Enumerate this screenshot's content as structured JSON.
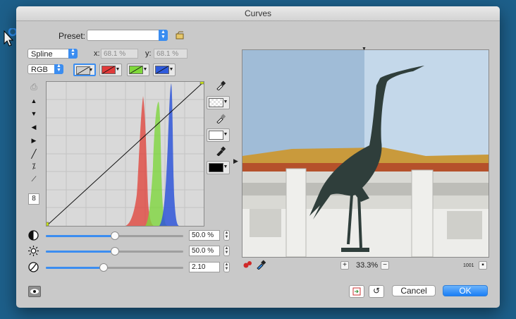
{
  "window": {
    "title": "Curves"
  },
  "preset": {
    "label": "Preset:",
    "value": ""
  },
  "mode": {
    "value": "Spline"
  },
  "channel": {
    "value": "RGB"
  },
  "coords": {
    "x_label": "x:",
    "x_value": "68.1 %",
    "y_label": "y:",
    "y_value": "68.1 %"
  },
  "curve_buttons": [
    {
      "name": "rgb",
      "color": "#cfcfcf"
    },
    {
      "name": "red",
      "color": "#e03a3a"
    },
    {
      "name": "green",
      "color": "#7fd83a"
    },
    {
      "name": "blue",
      "color": "#2f5bdc"
    }
  ],
  "tools": {
    "step_value": "8"
  },
  "sliders": [
    {
      "name": "contrast",
      "value": "50.0 %",
      "fraction": 0.5
    },
    {
      "name": "brightness",
      "value": "50.0 %",
      "fraction": 0.5
    },
    {
      "name": "gamma",
      "value": "2.10",
      "fraction": 0.42
    }
  ],
  "zoom": {
    "value": "33.3%"
  },
  "image_size": {
    "value": "1001"
  },
  "buttons": {
    "cancel": "Cancel",
    "ok": "OK"
  },
  "colors": {
    "accent": "#3b8df0",
    "histogram_red": "#e0473f",
    "histogram_green": "#7ed63d",
    "histogram_blue": "#2f56d8"
  }
}
